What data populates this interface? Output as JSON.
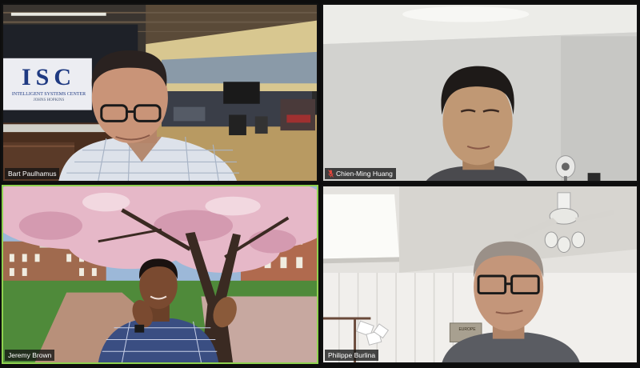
{
  "meeting": {
    "participants": [
      {
        "name": "Bart Paulhamus",
        "muted": false,
        "active_speaker": false
      },
      {
        "name": "Chien-Ming Huang",
        "muted": true,
        "active_speaker": false
      },
      {
        "name": "Jeremy Brown",
        "muted": false,
        "active_speaker": true
      },
      {
        "name": "Philippe Burlina",
        "muted": false,
        "active_speaker": false
      }
    ]
  },
  "backgrounds": {
    "bart": {
      "sign_letters": "ISC",
      "sign_subtitle": "INTELLIGENT SYSTEMS CENTER",
      "sign_footer": "JOHNS HOPKINS"
    },
    "philippe": {
      "poster_text": "EUROPE"
    }
  },
  "colors": {
    "active_border": "#8fd14f",
    "nameplate_bg": "#141414",
    "muted_icon": "#e0463c"
  }
}
